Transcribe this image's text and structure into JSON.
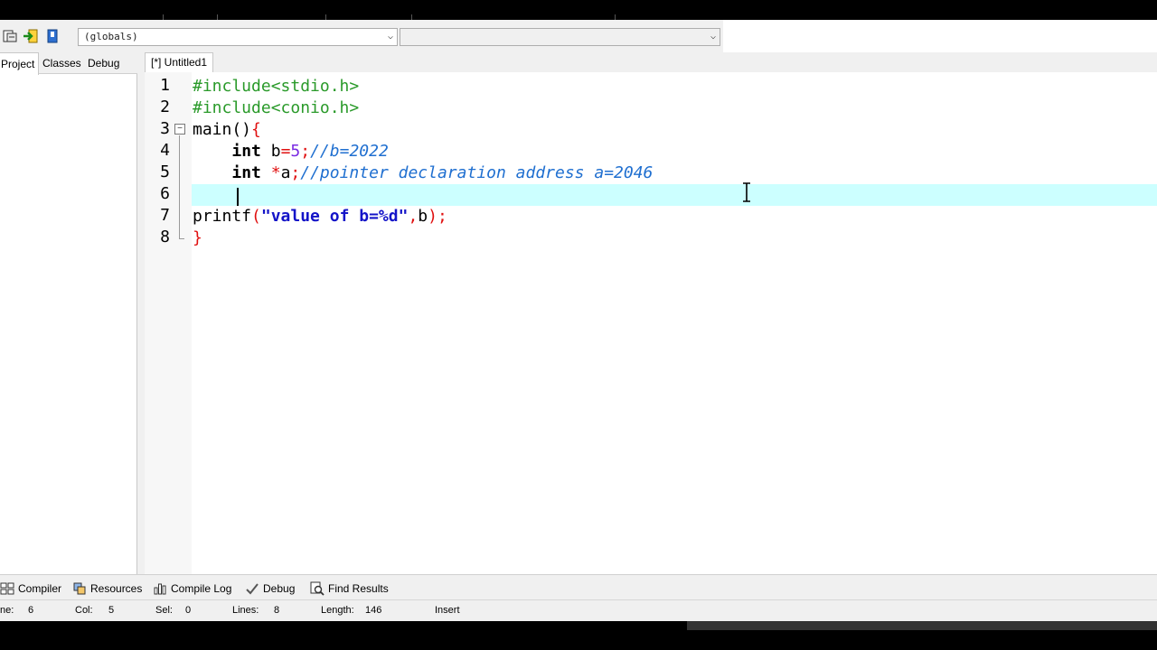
{
  "toolbar": {
    "scope_combo": "(globals)",
    "member_combo": ""
  },
  "left_panel": {
    "tabs": [
      {
        "label": "Project"
      },
      {
        "label": "Classes"
      },
      {
        "label": "Debug"
      }
    ]
  },
  "editor": {
    "tab_label": "[*] Untitled1",
    "line_numbers": [
      "1",
      "2",
      "3",
      "4",
      "5",
      "6",
      "7",
      "8"
    ],
    "lines": [
      {
        "pp": "#include<stdio.h>"
      },
      {
        "pp": "#include<conio.h>"
      },
      {
        "plain": "main()",
        "sym": "{"
      },
      {
        "indent": "    ",
        "kw": "int",
        "plain": " b",
        "sym": "=",
        "num": "5",
        "sym2": ";",
        "comment": "//b=2022"
      },
      {
        "indent": "    ",
        "kw": "int",
        "sym": " *",
        "plain": "a",
        "sym2": ";",
        "comment": "//pointer declaration address a=2046"
      },
      {
        "indent": "    "
      },
      {
        "plain": "printf",
        "sym": "(",
        "str": "\"value of b=%d\"",
        "sym2": ",",
        "plain2": "b",
        "sym3": ");"
      },
      {
        "sym": "}"
      }
    ],
    "highlight_color": "#ccffff"
  },
  "bottom_tabs": [
    {
      "label": "Compiler",
      "icon": "compiler-grid-icon"
    },
    {
      "label": "Resources",
      "icon": "resources-icon"
    },
    {
      "label": "Compile Log",
      "icon": "chart-icon"
    },
    {
      "label": "Debug",
      "icon": "check-icon"
    },
    {
      "label": "Find Results",
      "icon": "find-icon"
    }
  ],
  "status": {
    "line_label": "ne:",
    "line_value": "6",
    "col_label": "Col:",
    "col_value": "5",
    "sel_label": "Sel:",
    "sel_value": "0",
    "lines_label": "Lines:",
    "lines_value": "8",
    "length_label": "Length:",
    "length_value": "146",
    "mode": "Insert"
  }
}
